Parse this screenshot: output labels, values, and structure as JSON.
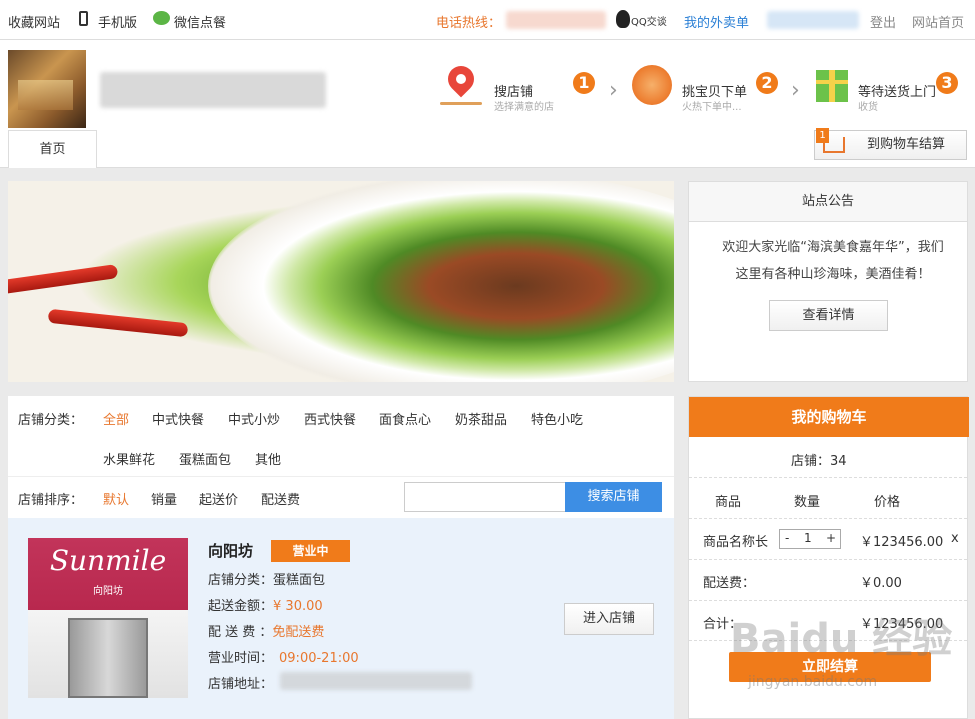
{
  "topbar": {
    "bookmark": "收藏网站",
    "mobile": "手机版",
    "wechat": "微信点餐",
    "hotline_label": "电话热线：",
    "qq": "QQ交谈",
    "my_orders": "我的外卖单",
    "logout": "登出",
    "site_home": "网站首页"
  },
  "header": {
    "steps": [
      {
        "title": "搜店铺",
        "sub": "选择满意的店",
        "num": "1"
      },
      {
        "title": "挑宝贝下单",
        "sub": "火热下单中...",
        "num": "2"
      },
      {
        "title": "等待送货上门",
        "sub": "收货",
        "num": "3"
      }
    ],
    "home_tab": "首页",
    "cart_count": "1",
    "cart_checkout": "到购物车结算"
  },
  "notice": {
    "title": "站点公告",
    "line1": "欢迎大家光临“海滨美食嘉年华”，我们",
    "line2": "这里有各种山珍海味，美酒佳肴！",
    "details_button": "查看详情"
  },
  "filter": {
    "category_label": "店铺分类：",
    "categories": [
      "全部",
      "中式快餐",
      "中式小炒",
      "西式快餐",
      "面食点心",
      "奶茶甜品",
      "特色小吃",
      "水果鲜花",
      "蛋糕面包",
      "其他"
    ],
    "sort_label": "店铺排序：",
    "sorts": [
      "默认",
      "销量",
      "起送价",
      "配送费"
    ],
    "search_button": "搜索店铺"
  },
  "shop": {
    "logo_text": "Sunmile",
    "logo_sub": "向阳坊",
    "name": "向阳坊",
    "status": "营业中",
    "category_label": "店铺分类：",
    "category": "蛋糕面包",
    "min_label": "起送金额：",
    "min_amount": "¥ 30.00",
    "fee_label": "配 送 费 ：",
    "fee": "免配送费",
    "hours_label": "营业时间：",
    "hours": "09:00-21:00",
    "address_label": "店铺地址：",
    "enter_button": "进入店铺"
  },
  "cart": {
    "title": "我的购物车",
    "shop_line": "店铺：34",
    "col_item": "商品",
    "col_qty": "数量",
    "col_price": "价格",
    "item_name": "商品名称长",
    "qty_minus": "-",
    "qty": "1",
    "qty_plus": "+",
    "item_price": "￥123456.00",
    "remove": "x",
    "fee_label": "配送费：",
    "fee": "￥0.00",
    "total_label": "合计：",
    "total": "￥123456.00",
    "checkout": "立即结算"
  },
  "watermark": {
    "main": "Baidu 经验",
    "sub": "jingyan.baidu.com"
  },
  "colors": {
    "accent": "#f07b1a",
    "blue": "#3d8ee4"
  }
}
